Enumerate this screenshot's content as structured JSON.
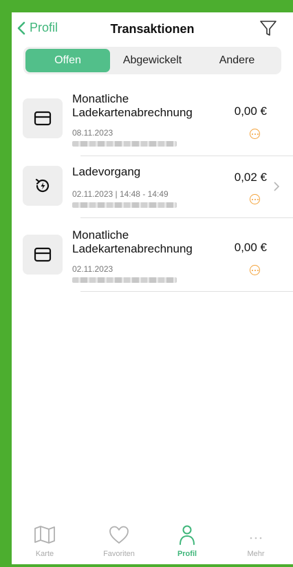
{
  "header": {
    "back_label": "Profil",
    "title": "Transaktionen"
  },
  "tabs": [
    {
      "label": "Offen",
      "active": true
    },
    {
      "label": "Abgewickelt",
      "active": false
    },
    {
      "label": "Andere",
      "active": false
    }
  ],
  "transactions": [
    {
      "name_line1": "Monatliche",
      "name_line2": "Ladekartenabrechnung",
      "date": "08.11.2023",
      "amount": "0,00 €",
      "icon": "card-icon"
    },
    {
      "name_line1": "Ladevorgang",
      "name_line2": "",
      "date": "02.11.2023 | 14:48 - 14:49",
      "amount": "0,02 €",
      "icon": "charging-history-icon"
    },
    {
      "name_line1": "Monatliche",
      "name_line2": "Ladekartenabrechnung",
      "date": "02.11.2023",
      "amount": "0,00 €",
      "icon": "card-icon"
    }
  ],
  "bottom_nav": [
    {
      "label": "Karte",
      "icon": "map-icon"
    },
    {
      "label": "Favoriten",
      "icon": "heart-icon"
    },
    {
      "label": "Profil",
      "icon": "person-icon",
      "active": true
    },
    {
      "label": "Mehr",
      "icon": "more-icon"
    }
  ],
  "colors": {
    "accent": "#3fb67a",
    "active_segment": "#52bf8a",
    "pending": "#f3a23a",
    "frame": "#4cae2f"
  }
}
